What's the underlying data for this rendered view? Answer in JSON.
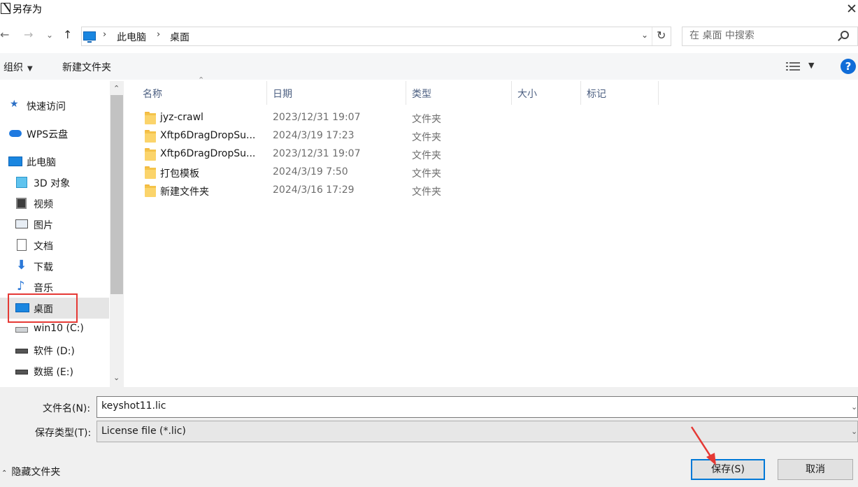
{
  "window": {
    "title": "另存为",
    "close_glyph": "✕"
  },
  "address": {
    "back": "←",
    "forward": "→",
    "recent": "⌄",
    "up": "↑",
    "breadcrumbs": [
      "此电脑",
      "桌面"
    ],
    "separator": "›",
    "dropdown": "⌄",
    "refresh": "↻"
  },
  "search": {
    "placeholder": "在 桌面 中搜索"
  },
  "toolbar": {
    "organize": "组织",
    "new_folder": "新建文件夹",
    "help": "?"
  },
  "nav": {
    "items": [
      {
        "label": "快速访问",
        "icon": "star-icon"
      },
      {
        "label": "WPS云盘",
        "icon": "cloud-icon"
      },
      {
        "label": "此电脑",
        "icon": "computer-icon"
      },
      {
        "label": "3D 对象",
        "icon": "3d-objects-icon"
      },
      {
        "label": "视频",
        "icon": "video-icon"
      },
      {
        "label": "图片",
        "icon": "pictures-icon"
      },
      {
        "label": "文档",
        "icon": "documents-icon"
      },
      {
        "label": "下载",
        "icon": "download-icon"
      },
      {
        "label": "音乐",
        "icon": "music-icon"
      },
      {
        "label": "桌面",
        "icon": "desktop-icon",
        "selected": true
      },
      {
        "label": "win10 (C:)",
        "icon": "system-drive-icon"
      },
      {
        "label": "软件 (D:)",
        "icon": "drive-icon"
      },
      {
        "label": "数据 (E:)",
        "icon": "drive-icon"
      }
    ]
  },
  "columns": [
    "名称",
    "日期",
    "类型",
    "大小",
    "标记"
  ],
  "files": [
    {
      "name": "jyz-crawl",
      "date": "2023/12/31 19:07",
      "type": "文件夹"
    },
    {
      "name": "Xftp6DragDropSu...",
      "date": "2024/3/19 17:23",
      "type": "文件夹"
    },
    {
      "name": "Xftp6DragDropSu...",
      "date": "2023/12/31 19:07",
      "type": "文件夹"
    },
    {
      "name": "打包模板",
      "date": "2024/3/19 7:50",
      "type": "文件夹"
    },
    {
      "name": "新建文件夹",
      "date": "2024/3/16 17:29",
      "type": "文件夹"
    }
  ],
  "form": {
    "filename_label": "文件名(N):",
    "filename_value": "keyshot11.lic",
    "filetype_label": "保存类型(T):",
    "filetype_value": "License file (*.lic)"
  },
  "footer": {
    "hide_folders": "隐藏文件夹",
    "save": "保存(S)",
    "cancel": "取消"
  },
  "colors": {
    "accent": "#0078d7",
    "highlight": "#e53935",
    "folder": "#fbd46b"
  }
}
